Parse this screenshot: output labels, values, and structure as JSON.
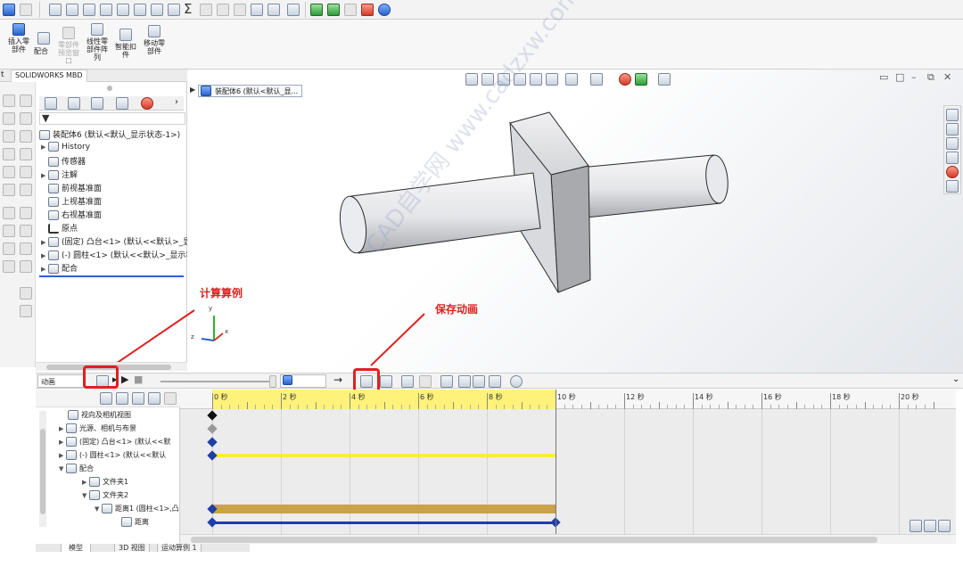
{
  "ribbon": {
    "buttons": [
      {
        "label": "插入零\n部件"
      },
      {
        "label": "配合"
      },
      {
        "label": "零部件\n预览窗\n口"
      },
      {
        "label": "线性零\n部件阵\n列"
      },
      {
        "label": "智能扣\n件"
      },
      {
        "label": "移动零\n部件"
      }
    ]
  },
  "tabs": {
    "first": "t",
    "mbd": "SOLIDWORKS MBD"
  },
  "tree": {
    "root": "装配体6 (默认<默认_显示状态-1>)",
    "items": [
      {
        "label": "History"
      },
      {
        "label": "传感器"
      },
      {
        "label": "注解"
      },
      {
        "label": "前视基准面"
      },
      {
        "label": "上视基准面"
      },
      {
        "label": "右视基准面"
      },
      {
        "label": "原点"
      },
      {
        "label": "(固定) 凸台<1> (默认<<默认>_显示"
      },
      {
        "label": "(-) 圆柱<1> (默认<<默认>_显示状态"
      },
      {
        "label": "配合"
      }
    ]
  },
  "viewport": {
    "breadcrumb": "装配体6 (默认<默认_显..."
  },
  "watermark": "CAD自学网 www.cadzxw.com",
  "annotations": {
    "calc": "计算算例",
    "save": "保存动画"
  },
  "motion": {
    "study_type": "动画",
    "tree": [
      {
        "label": "视向及相机视图"
      },
      {
        "label": "光源、相机与布景"
      },
      {
        "label": "(固定) 凸台<1> (默认<<默"
      },
      {
        "label": "(-) 圆柱<1> (默认<<默认"
      },
      {
        "label": "配合"
      },
      {
        "label": "文件夹1"
      },
      {
        "label": "文件夹2"
      },
      {
        "label": "距离1 (圆柱<1>,凸"
      },
      {
        "label": "距离"
      }
    ],
    "ticks": [
      "0 秒",
      "2 秒",
      "4 秒",
      "6 秒",
      "8 秒",
      "10 秒",
      "12 秒",
      "14 秒",
      "16 秒",
      "18 秒",
      "20 秒"
    ],
    "duration": 10,
    "total": 21,
    "bottom_tabs": [
      "模型",
      "3D 视图",
      "运动算例 1"
    ]
  }
}
